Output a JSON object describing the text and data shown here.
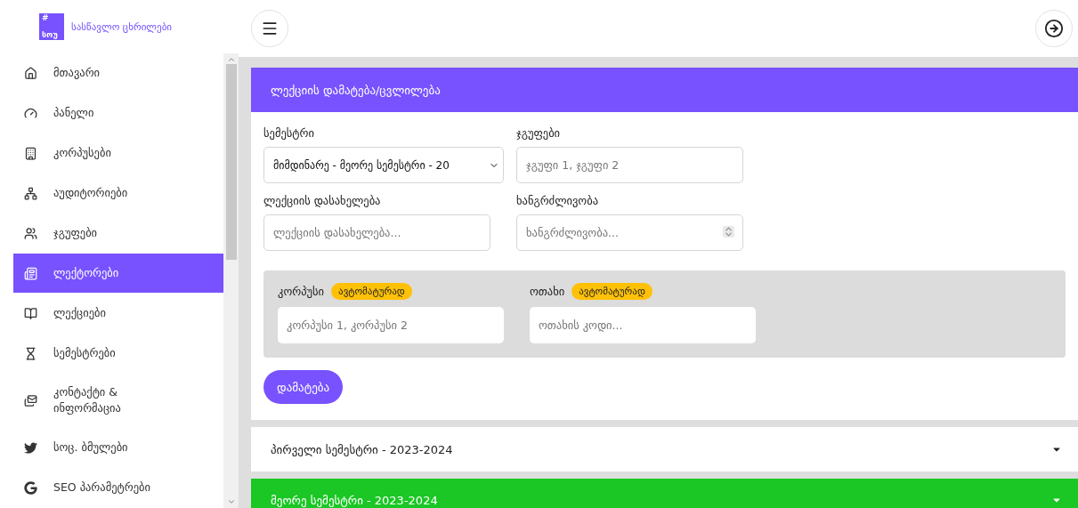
{
  "logo": {
    "mark": "#",
    "badge": "სოუ",
    "title": "სასწავლო ცხრილები"
  },
  "sidebar": {
    "items": [
      {
        "label": "მთავარი",
        "selected": false
      },
      {
        "label": "პანელი",
        "selected": false
      },
      {
        "label": "კორპუსები",
        "selected": false
      },
      {
        "label": "აუდიტორიები",
        "selected": false
      },
      {
        "label": "ჯგუფები",
        "selected": false
      },
      {
        "label": "ლექტორები",
        "selected": true
      },
      {
        "label": "ლექციები",
        "selected": false
      },
      {
        "label": "სემესტრები",
        "selected": false
      },
      {
        "label": "კონტაქტი & ინფორმაცია",
        "selected": false
      },
      {
        "label": "სოც. ბმულები",
        "selected": false
      },
      {
        "label": "SEO პარამეტრები",
        "selected": false
      }
    ]
  },
  "card": {
    "title": "ლექციის დამატება/ცვლილება",
    "fields": [
      {
        "kind": "select",
        "label": "სემესტრი",
        "value": "მიმდინარე - მეორე სემესტრი - 20"
      },
      {
        "kind": "text",
        "label": "ჯგუფები",
        "placeholder": "ჯგუფი 1, ჯგუფი 2"
      },
      {
        "kind": "text",
        "label": "ლექციის დასახელება",
        "placeholder": "ლექციის დასახელება..."
      },
      {
        "kind": "number",
        "label": "ხანგრძლივობა",
        "placeholder": "ხანგრძლივობა..."
      }
    ],
    "location_fields": [
      {
        "label": "კორპუსი",
        "badge": "ავტომატურად",
        "placeholder": "კორპუსი 1, კორპუსი 2"
      },
      {
        "label": "ოთახი",
        "badge": "ავტომატურად",
        "placeholder": "ოთახის კოდი..."
      }
    ],
    "submit": "დამატება"
  },
  "semesters": [
    {
      "title": "პირველი სემესტრი - 2023-2024",
      "highlighted": false
    },
    {
      "title": "მეორე სემესტრი - 2023-2024",
      "highlighted": true
    }
  ]
}
